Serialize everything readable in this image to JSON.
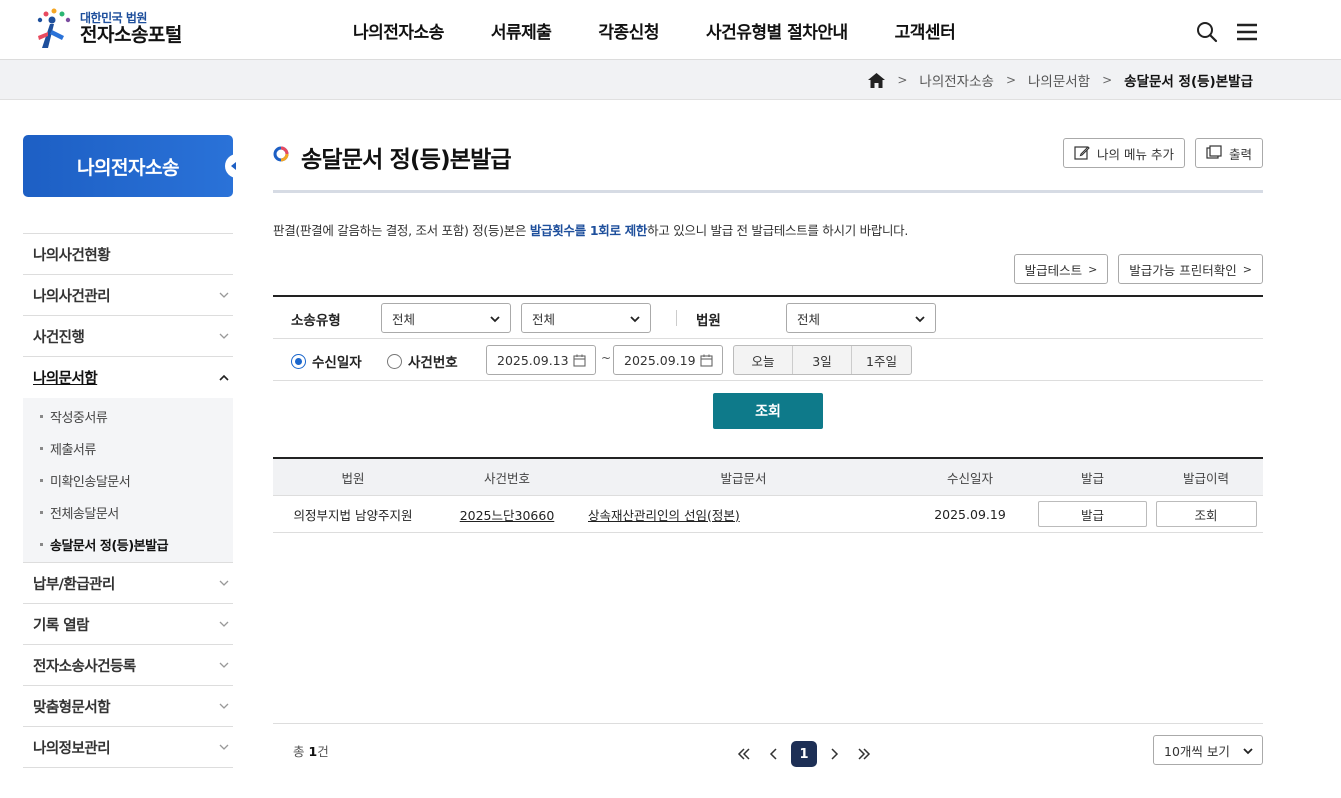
{
  "header": {
    "logo_sub": "대한민국 법원",
    "logo_main": "전자소송포털",
    "nav": [
      "나의전자소송",
      "서류제출",
      "각종신청",
      "사건유형별 절차안내",
      "고객센터"
    ]
  },
  "breadcrumb": {
    "items": [
      "나의전자소송",
      "나의문서함"
    ],
    "current": "송달문서 정(등)본발급"
  },
  "sidebar": {
    "title": "나의전자소송",
    "items": [
      {
        "label": "나의사건현황"
      },
      {
        "label": "나의사건관리"
      },
      {
        "label": "사건진행"
      },
      {
        "label": "나의문서함"
      },
      {
        "label": "납부/환급관리"
      },
      {
        "label": "기록 열람"
      },
      {
        "label": "전자소송사건등록"
      },
      {
        "label": "맞춤형문서함"
      },
      {
        "label": "나의정보관리"
      }
    ],
    "subitems": [
      "작성중서류",
      "제출서류",
      "미확인송달문서",
      "전체송달문서",
      "송달문서 정(등)본발급"
    ]
  },
  "page": {
    "title": "송달문서 정(등)본발급",
    "add_menu": "나의 메뉴 추가",
    "print": "출력",
    "notice_pre": "판결(판결에 갈음하는 결정, 조서 포함) 정(등)본은 ",
    "notice_strong": "발급횟수를 1회로 제한",
    "notice_post": "하고 있으니 발급 전 발급테스트를 하시기 바랍니다.",
    "test_btn": "발급테스트",
    "printer_btn": "발급가능 프린터확인"
  },
  "search": {
    "type_label": "소송유형",
    "type1": "전체",
    "type2": "전체",
    "court_label": "법원",
    "court": "전체",
    "radio_date": "수신일자",
    "radio_case": "사건번호",
    "date_from": "2025.09.13",
    "tilde": "~",
    "date_to": "2025.09.19",
    "periods": [
      "오늘",
      "3일",
      "1주일"
    ],
    "submit": "조회"
  },
  "table": {
    "headers": [
      "법원",
      "사건번호",
      "발급문서",
      "수신일자",
      "발급",
      "발급이력"
    ],
    "rows": [
      {
        "court": "의정부지법 남양주지원",
        "case_no": "2025느단30660",
        "doc": "상속재산관리인의 선임(정본)",
        "date": "2025.09.19",
        "issue": "발급",
        "history": "조회"
      }
    ]
  },
  "pagination": {
    "total_pre": "총 ",
    "total_count": "1",
    "total_post": "건",
    "current_page": "1",
    "page_size": "10개씩 보기"
  },
  "colors": {
    "primary": "#1d5fc4",
    "search_button": "#0e7a8a",
    "pager_active": "#1d2f55"
  },
  "icons": [
    "home-icon",
    "search-icon",
    "menu-icon",
    "edit-icon",
    "print-icon",
    "calendar-icon"
  ]
}
